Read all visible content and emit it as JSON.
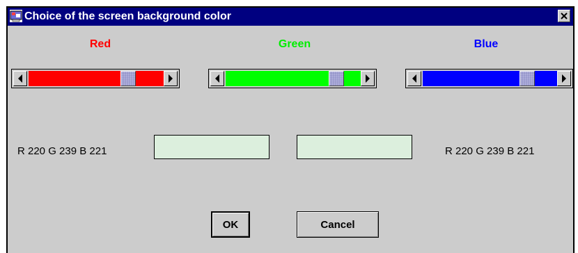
{
  "window": {
    "title": "Choice of the screen background color"
  },
  "channels": [
    {
      "label": "Red",
      "color": "#ff0000",
      "value_fraction": 0.77
    },
    {
      "label": "Green",
      "color": "#00ff00",
      "value_fraction": 0.86
    },
    {
      "label": "Blue",
      "color": "#0000ff",
      "value_fraction": 0.81
    }
  ],
  "left_readout": "R 220  G 239  B 221",
  "right_readout": "R 220  G 239  B 221",
  "swatch_color": "#dcefdd",
  "buttons": {
    "ok_label": "OK",
    "cancel_label": "Cancel"
  },
  "colors": {
    "titlebar": "#000080",
    "window_bg": "#cccccc",
    "thumb": "#9999cc"
  }
}
